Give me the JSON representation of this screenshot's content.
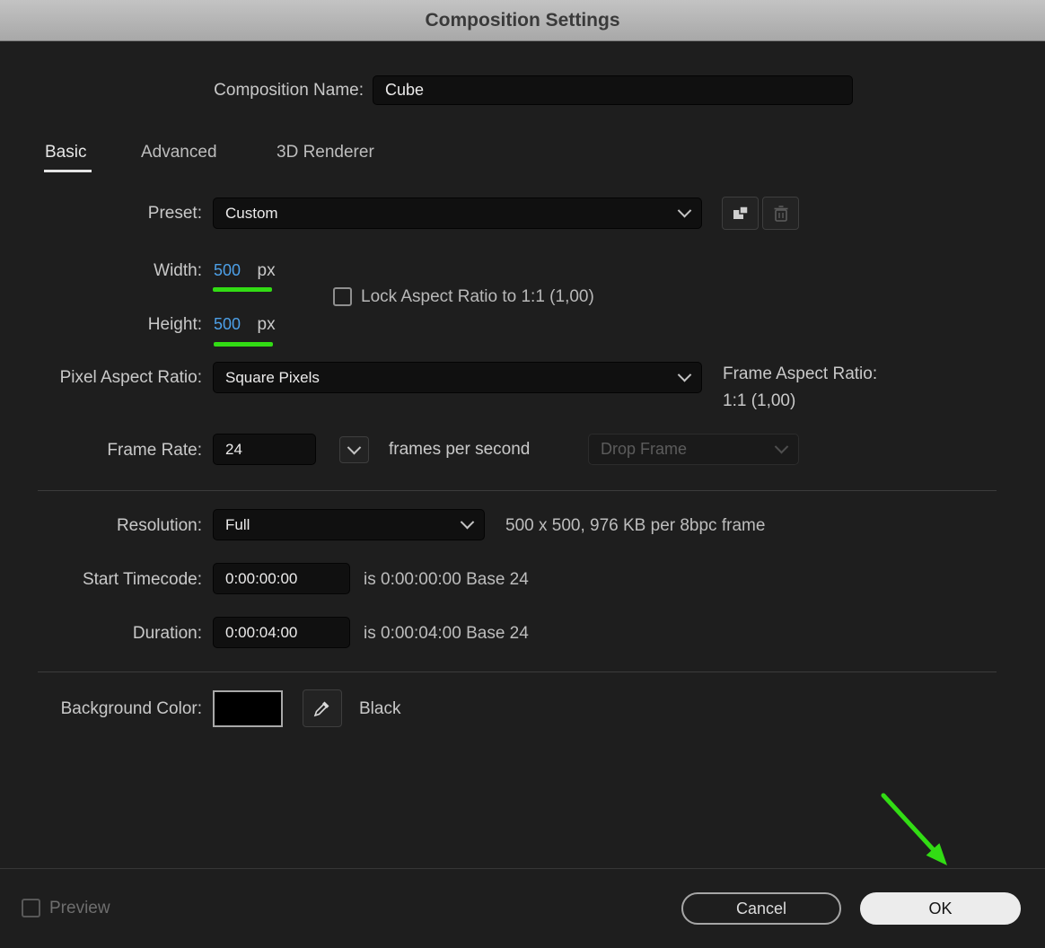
{
  "titlebar": {
    "title": "Composition Settings"
  },
  "composition_name": {
    "label": "Composition Name:",
    "value": "Cube"
  },
  "tabs": [
    {
      "label": "Basic",
      "active": true
    },
    {
      "label": "Advanced",
      "active": false
    },
    {
      "label": "3D Renderer",
      "active": false
    }
  ],
  "preset": {
    "label": "Preset:",
    "value": "Custom"
  },
  "width": {
    "label": "Width:",
    "value": "500",
    "unit": "px"
  },
  "lock_aspect": {
    "label": "Lock Aspect Ratio to 1:1 (1,00)",
    "checked": false
  },
  "height": {
    "label": "Height:",
    "value": "500",
    "unit": "px"
  },
  "pixel_aspect_ratio": {
    "label": "Pixel Aspect Ratio:",
    "value": "Square Pixels"
  },
  "frame_aspect_ratio": {
    "label": "Frame Aspect Ratio:",
    "value": "1:1 (1,00)"
  },
  "frame_rate": {
    "label": "Frame Rate:",
    "value": "24",
    "unit": "frames per second",
    "drop_frame_value": "Drop Frame"
  },
  "resolution": {
    "label": "Resolution:",
    "value": "Full",
    "info": "500 x 500, 976 KB per 8bpc frame"
  },
  "start_timecode": {
    "label": "Start Timecode:",
    "value": "0:00:00:00",
    "info": "is 0:00:00:00  Base 24"
  },
  "duration": {
    "label": "Duration:",
    "value": "0:00:04:00",
    "info": "is 0:00:04:00  Base 24"
  },
  "background_color": {
    "label": "Background Color:",
    "color": "#000000",
    "color_name": "Black"
  },
  "footer": {
    "preview_label": "Preview",
    "cancel_label": "Cancel",
    "ok_label": "OK"
  },
  "icons": {
    "preset_save": "save-preset-icon",
    "preset_delete": "trash-icon",
    "dropdown": "chevron-down-icon",
    "eyedropper": "eyedropper-icon",
    "annotation": "green-arrow-annotation"
  },
  "colors": {
    "accent-blue": "#4da0e8",
    "annotation-green": "#32dc14",
    "background": "#1e1e1e",
    "titlebar-gray": "#b5b5b5"
  }
}
